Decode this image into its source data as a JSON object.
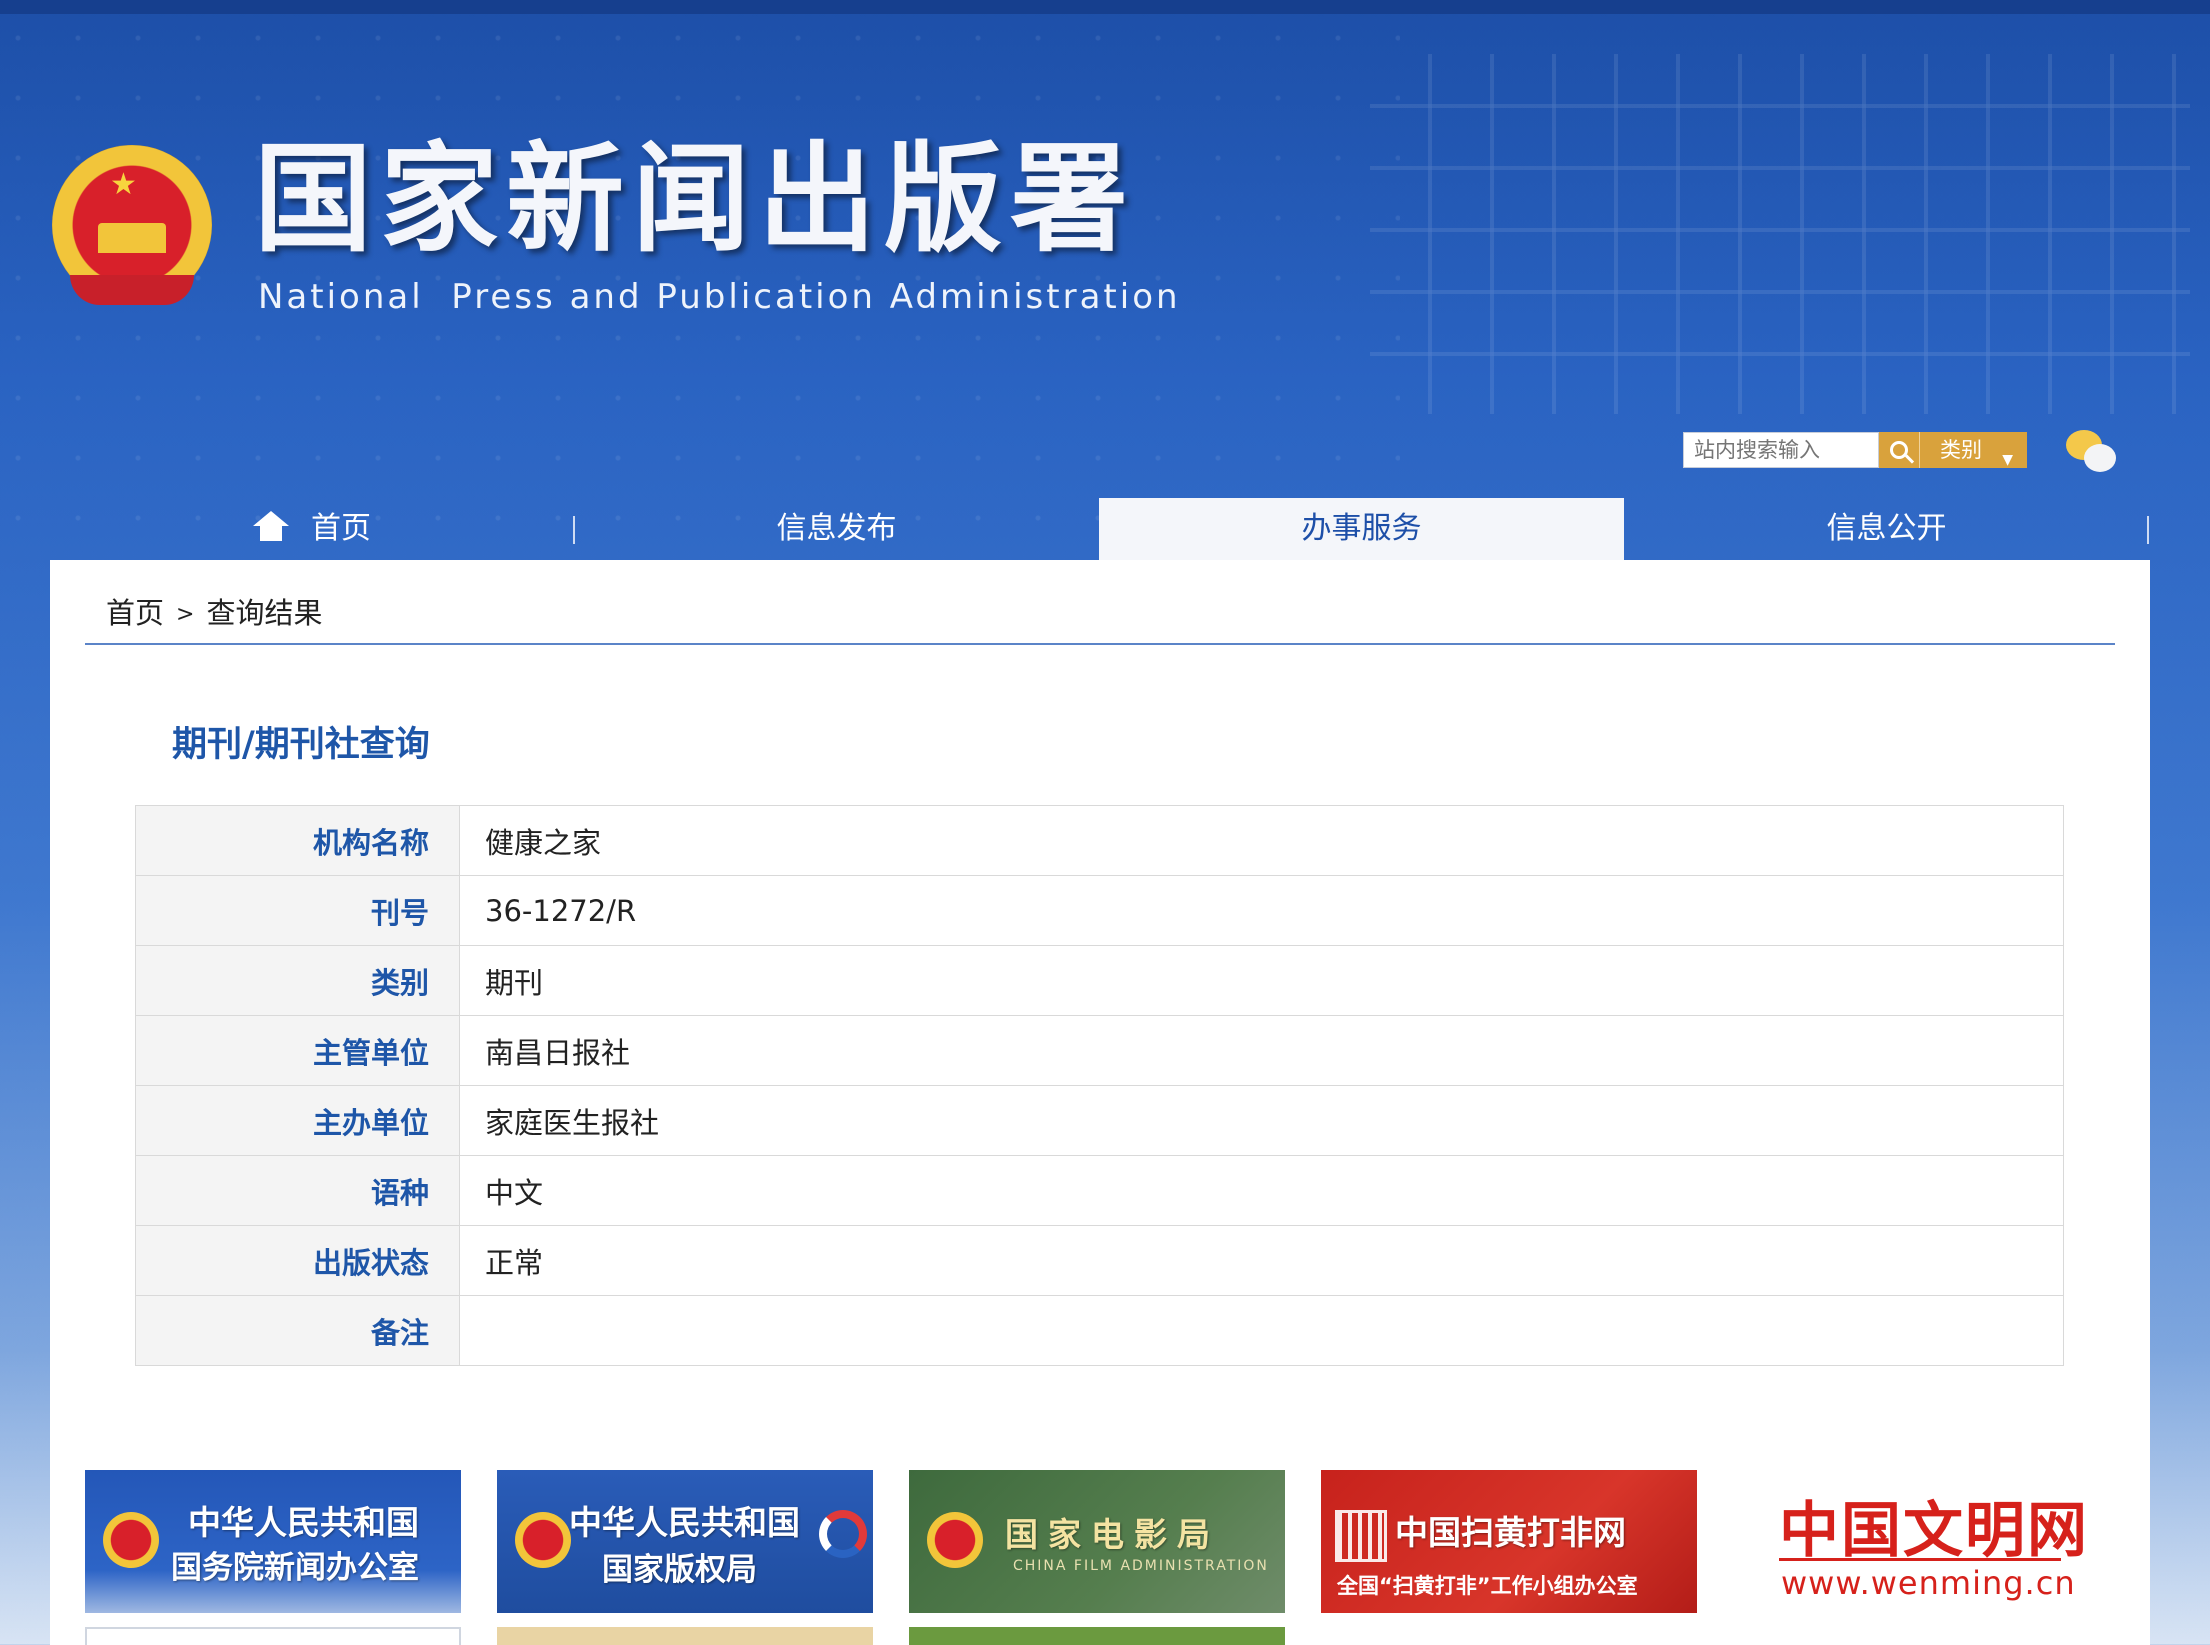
{
  "header": {
    "title_cn": "国家新闻出版署",
    "title_en": "National  Press and Publication Administration",
    "search_placeholder": "站内搜索输入",
    "category_label": "类别"
  },
  "nav": {
    "items": [
      {
        "label": "首页"
      },
      {
        "label": "信息发布"
      },
      {
        "label": "办事服务"
      },
      {
        "label": "信息公开"
      }
    ],
    "active": "办事服务"
  },
  "breadcrumb": {
    "home": "首页",
    "separator": ">",
    "current": "查询结果"
  },
  "main": {
    "section_title": "期刊/期刊社查询",
    "rows": [
      {
        "label": "机构名称",
        "value": "健康之家"
      },
      {
        "label": "刊号",
        "value": "36-1272/R"
      },
      {
        "label": "类别",
        "value": "期刊"
      },
      {
        "label": "主管单位",
        "value": "南昌日报社"
      },
      {
        "label": "主办单位",
        "value": "家庭医生报社"
      },
      {
        "label": "语种",
        "value": "中文"
      },
      {
        "label": "出版状态",
        "value": "正常"
      },
      {
        "label": "备注",
        "value": ""
      }
    ]
  },
  "links": {
    "scio": {
      "line1": "中华人民共和国",
      "line2": "国务院新闻办公室"
    },
    "ncac": {
      "line1": "中华人民共和国",
      "line2": "国家版权局"
    },
    "film": {
      "line1": "国家电影局",
      "line2": "CHINA FILM ADMINISTRATION"
    },
    "shdf": {
      "line1": "中国扫黄打非网",
      "line2": "全国“扫黄打非”工作小组办公室"
    },
    "wenming": {
      "line1": "中国文明网",
      "line2": "www.wenming.cn"
    }
  },
  "colors": {
    "brand_blue": "#1d4fa8",
    "label_blue": "#1e56a8",
    "accent_gold": "#d9a23c"
  },
  "icons": [
    "national-emblem-icon",
    "search-icon",
    "chevron-down-icon",
    "wechat-icon",
    "home-icon"
  ]
}
